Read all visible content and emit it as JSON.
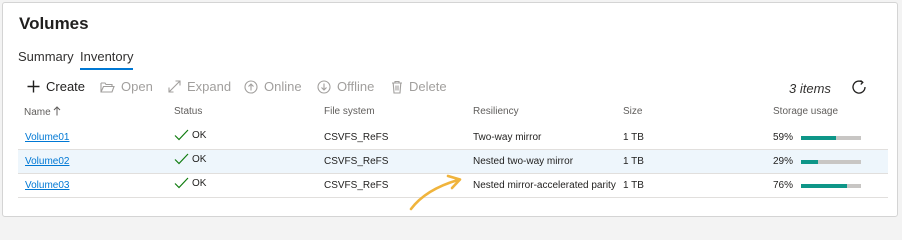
{
  "page": {
    "title": "Volumes"
  },
  "tabs": [
    {
      "label": "Summary",
      "active": false
    },
    {
      "label": "Inventory",
      "active": true
    }
  ],
  "toolbar": {
    "create": "Create",
    "open": "Open",
    "expand": "Expand",
    "online": "Online",
    "offline": "Offline",
    "delete": "Delete",
    "items_count": "3 items"
  },
  "columns": {
    "name": "Name",
    "status": "Status",
    "filesystem": "File system",
    "resiliency": "Resiliency",
    "size": "Size",
    "usage": "Storage usage"
  },
  "rows": [
    {
      "name": "Volume01",
      "status": "OK",
      "filesystem": "CSVFS_ReFS",
      "resiliency": "Two-way mirror",
      "size": "1 TB",
      "usage_label": "59%",
      "usage_fraction": 0.59,
      "selected": false
    },
    {
      "name": "Volume02",
      "status": "OK",
      "filesystem": "CSVFS_ReFS",
      "resiliency": "Nested two-way mirror",
      "size": "1 TB",
      "usage_label": "29%",
      "usage_fraction": 0.29,
      "selected": true
    },
    {
      "name": "Volume03",
      "status": "OK",
      "filesystem": "CSVFS_ReFS",
      "resiliency": "Nested mirror-accelerated parity",
      "size": "1 TB",
      "usage_label": "76%",
      "usage_fraction": 0.76,
      "selected": false
    }
  ],
  "colors": {
    "accent": "#0078d4",
    "usage_bar": "#0e9688",
    "annotation_arrow": "#f0b43c",
    "ok_check": "#107c10"
  }
}
